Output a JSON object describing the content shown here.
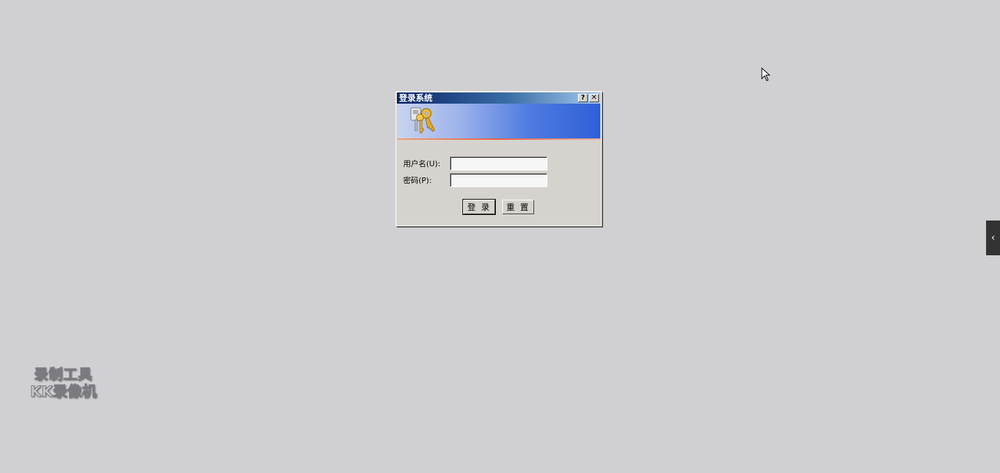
{
  "dialog": {
    "title": "登录系统",
    "help_button": "?",
    "close_button": "✕",
    "username_label": "用户名(U):",
    "username_value": "",
    "password_label": "密码(P):",
    "password_value": "",
    "login_button": "登 录",
    "reset_button": "重 置"
  },
  "side_tab": {
    "icon": "chevron-left-icon",
    "glyph": "‹"
  },
  "watermark": {
    "line1": "录制工具",
    "line2": "KK录像机"
  },
  "colors": {
    "desktop": "#d0cfd2",
    "dialog": "#d6d3ce",
    "title_start": "#0a246a",
    "banner_blue": "#2f5fd8",
    "side_tab": "#333333"
  }
}
